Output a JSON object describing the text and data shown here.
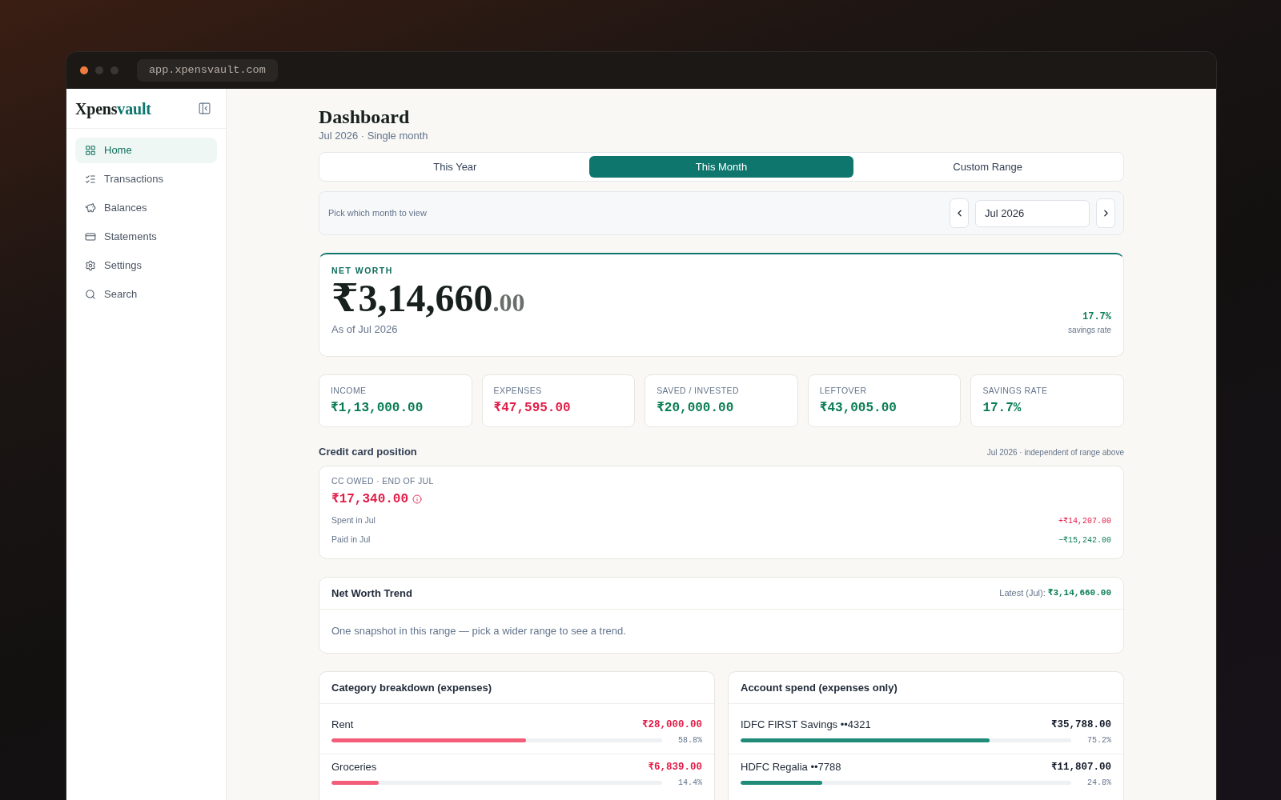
{
  "browser": {
    "url": "app.xpensvault.com"
  },
  "sidebar": {
    "logo": {
      "main": "Xpens",
      "accent": "vault"
    },
    "items": [
      {
        "label": "Home",
        "selected": true
      },
      {
        "label": "Transactions",
        "selected": false
      },
      {
        "label": "Balances",
        "selected": false
      },
      {
        "label": "Statements",
        "selected": false
      },
      {
        "label": "Settings",
        "selected": false
      },
      {
        "label": "Search",
        "selected": false
      }
    ]
  },
  "header": {
    "title": "Dashboard",
    "subtitle": "Jul 2026 · Single month"
  },
  "range_tabs": [
    {
      "label": "This Year",
      "selected": false
    },
    {
      "label": "This Month",
      "selected": true
    },
    {
      "label": "Custom Range",
      "selected": false
    }
  ],
  "month_picker": {
    "hint": "Pick which month to view",
    "value": "Jul 2026"
  },
  "net_worth": {
    "label": "NET WORTH",
    "amount": "₹3,14,660",
    "amount_fraction": ".00",
    "as_of": "As of Jul 2026",
    "savings_rate": "17.7%",
    "savings_rate_label": "savings rate"
  },
  "stats": [
    {
      "label": "INCOME",
      "value": "₹1,13,000.00",
      "color": "#0a7c53"
    },
    {
      "label": "EXPENSES",
      "value": "₹47,595.00",
      "color": "#e11d48"
    },
    {
      "label": "SAVED / INVESTED",
      "value": "₹20,000.00",
      "color": "#0a7c53"
    },
    {
      "label": "LEFTOVER",
      "value": "₹43,005.00",
      "color": "#0a7c53"
    },
    {
      "label": "SAVINGS RATE",
      "value": "17.7%",
      "color": "#0a7c53"
    }
  ],
  "credit_card": {
    "heading": "Credit card position",
    "note": "Jul 2026 · independent of range above",
    "owed_label": "CC OWED · END OF JUL",
    "owed_amount": "₹17,340.00",
    "rows": [
      {
        "label": "Spent in Jul",
        "value": "+₹14,207.00",
        "color": "#e11d48"
      },
      {
        "label": "Paid in Jul",
        "value": "−₹15,242.00",
        "color": "#0a7c53"
      }
    ]
  },
  "net_worth_trend": {
    "title": "Net Worth Trend",
    "latest_label": "Latest (Jul):",
    "latest_value": "₹3,14,660.00",
    "message": "One snapshot in this range — pick a wider range to see a trend."
  },
  "category_breakdown": {
    "title": "Category breakdown (expenses)",
    "rows": [
      {
        "name": "Rent",
        "amount": "₹28,000.00",
        "level": 0.588,
        "percent": "58.8%"
      },
      {
        "name": "Groceries",
        "amount": "₹6,839.00",
        "level": 0.144,
        "percent": "14.4%"
      }
    ]
  },
  "account_spend": {
    "title": "Account spend (expenses only)",
    "rows": [
      {
        "name": "IDFC FIRST Savings ••4321",
        "amount": "₹35,788.00",
        "level": 0.752,
        "percent": "75.2%"
      },
      {
        "name": "HDFC Regalia ••7788",
        "amount": "₹11,807.00",
        "level": 0.248,
        "percent": "24.8%"
      }
    ]
  }
}
